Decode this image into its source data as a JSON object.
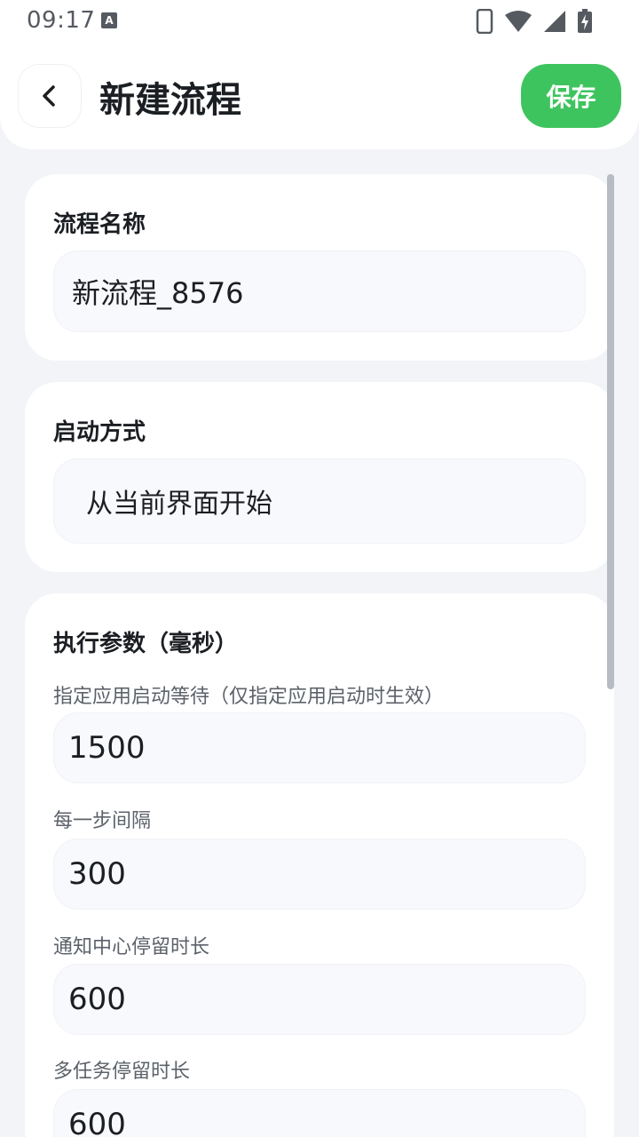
{
  "status_bar": {
    "time": "09:17",
    "notification_glyph": "A",
    "icons": [
      "phone-icon",
      "wifi-icon",
      "signal-icon",
      "battery-charging-icon"
    ]
  },
  "header": {
    "title": "新建流程",
    "save_label": "保存",
    "back_icon": "chevron-left-icon"
  },
  "colors": {
    "accent": "#3ec45f",
    "background": "#f2f4f7",
    "text": "#1b1e22"
  },
  "name_card": {
    "title": "流程名称",
    "value": "新流程_8576"
  },
  "launch_card": {
    "title": "启动方式",
    "value": "从当前界面开始"
  },
  "params_card": {
    "title": "执行参数（毫秒）",
    "fields": [
      {
        "label": "指定应用启动等待（仅指定应用启动时生效）",
        "value": "1500"
      },
      {
        "label": "每一步间隔",
        "value": "300"
      },
      {
        "label": "通知中心停留时长",
        "value": "600"
      },
      {
        "label": "多任务停留时长",
        "value": "600"
      }
    ]
  }
}
